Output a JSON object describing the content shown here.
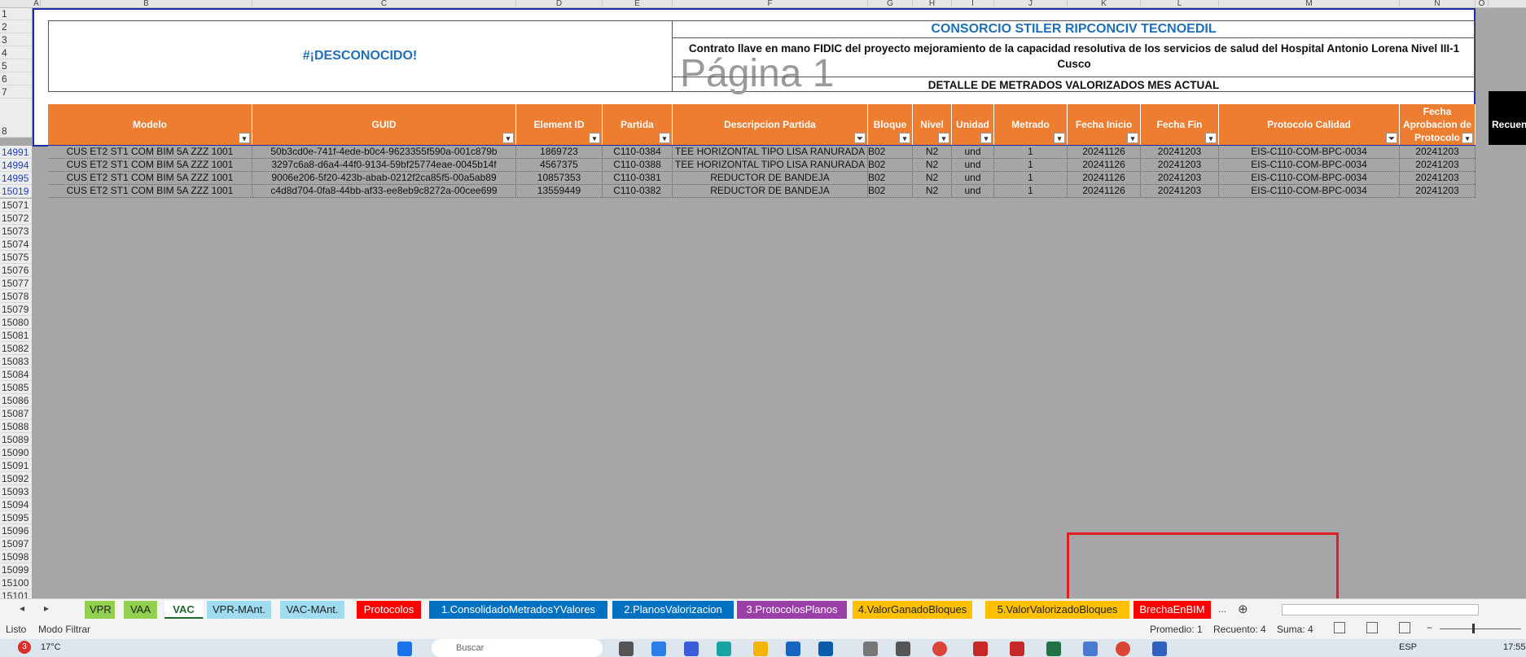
{
  "columns": [
    "A",
    "B",
    "C",
    "D",
    "E",
    "F",
    "G",
    "H",
    "I",
    "J",
    "K",
    "L",
    "M",
    "N",
    "O"
  ],
  "row_numbers_top": [
    "1",
    "2",
    "3",
    "4",
    "5",
    "6",
    "7",
    "8"
  ],
  "row_numbers_data": [
    "14991",
    "14994",
    "14995",
    "15019"
  ],
  "row_numbers_empty": [
    "15071",
    "15072",
    "15073",
    "15074",
    "15075",
    "15076",
    "15077",
    "15078",
    "15079",
    "15080",
    "15081",
    "15082",
    "15083",
    "15084",
    "15085",
    "15086",
    "15087",
    "15088",
    "15089",
    "15090",
    "15091",
    "15092",
    "15093",
    "15094",
    "15095",
    "15096",
    "15097",
    "15098",
    "15099",
    "15100",
    "15101"
  ],
  "header": {
    "desconocido": "#¡DESCONOCIDO!",
    "consorcio": "CONSORCIO STILER RIPCONCIV TECNOEDIL",
    "contrato": "Contrato llave en mano FIDIC del proyecto mejoramiento de la capacidad resolutiva de los servicios de salud del Hospital Antonio Lorena Nivel III-1 Cusco",
    "pagina": "Página 1",
    "detalle": "DETALLE DE METRADOS VALORIZADOS MES ACTUAL"
  },
  "table": {
    "headers": [
      "Modelo",
      "GUID",
      "Element ID",
      "Partida",
      "Descripcion Partida",
      "Bloque",
      "Nivel",
      "Unidad",
      "Metrado",
      "Fecha Inicio",
      "Fecha Fin",
      "Protocolo Calidad",
      "Fecha Aprobacion de Protocolo"
    ],
    "rows": [
      [
        "CUS ET2 ST1 COM BIM 5A ZZZ 1001",
        "50b3cd0e-741f-4ede-b0c4-9623355f590a-001c879b",
        "1869723",
        "C110-0384",
        "TEE HORIZONTAL TIPO LISA RANURADA",
        "B02",
        "N2",
        "und",
        "1",
        "20241126",
        "20241203",
        "EIS-C110-COM-BPC-0034",
        "20241203"
      ],
      [
        "CUS ET2 ST1 COM BIM 5A ZZZ 1001",
        "3297c6a8-d6a4-44f0-9134-59bf25774eae-0045b14f",
        "4567375",
        "C110-0388",
        "TEE HORIZONTAL TIPO LISA RANURADA",
        "B02",
        "N2",
        "und",
        "1",
        "20241126",
        "20241203",
        "EIS-C110-COM-BPC-0034",
        "20241203"
      ],
      [
        "CUS ET2 ST1 COM BIM 5A ZZZ 1001",
        "9006e206-5f20-423b-abab-0212f2ca85f5-00a5ab89",
        "10857353",
        "C110-0381",
        "REDUCTOR DE BANDEJA",
        "B02",
        "N2",
        "und",
        "1",
        "20241126",
        "20241203",
        "EIS-C110-COM-BPC-0034",
        "20241203"
      ],
      [
        "CUS ET2 ST1 COM BIM 5A ZZZ 1001",
        "c4d8d704-0fa8-44bb-af33-ee8eb9c8272a-00cee699",
        "13559449",
        "C110-0382",
        "REDUCTOR DE BANDEJA",
        "B02",
        "N2",
        "und",
        "1",
        "20241126",
        "20241203",
        "EIS-C110-COM-BPC-0034",
        "20241203"
      ]
    ]
  },
  "recuento_label": "Recuento",
  "sheet_tabs": [
    {
      "label": "VPR",
      "bg": "#92d050",
      "color": "#222"
    },
    {
      "label": "VAA",
      "bg": "#92d050",
      "color": "#222"
    },
    {
      "label": "VAC",
      "bg": "#ffffff",
      "color": "#1e6b2e"
    },
    {
      "label": "VPR-MAnt.",
      "bg": "#9fdcf0",
      "color": "#222"
    },
    {
      "label": "VAC-MAnt.",
      "bg": "#9fdcf0",
      "color": "#222"
    },
    {
      "label": "Protocolos",
      "bg": "#ff0000",
      "color": "#fff"
    },
    {
      "label": "1.ConsolidadoMetradosYValores",
      "bg": "#0070c0",
      "color": "#fff"
    },
    {
      "label": "2.PlanosValorizacion",
      "bg": "#0070c0",
      "color": "#fff"
    },
    {
      "label": "3.ProtocolosPlanos",
      "bg": "#9b3fa8",
      "color": "#fff"
    },
    {
      "label": "4.ValorGanadoBloques",
      "bg": "#ffc000",
      "color": "#222"
    },
    {
      "label": "5.ValorValorizadoBloques",
      "bg": "#ffc000",
      "color": "#222"
    },
    {
      "label": "BrechaEnBIM",
      "bg": "#ff0000",
      "color": "#fff"
    }
  ],
  "tabs_more": "...",
  "status": {
    "listo": "Listo",
    "modo": "Modo Filtrar",
    "promedio": "Promedio: 1",
    "recuento": "Recuento: 4",
    "suma": "Suma: 4"
  },
  "taskbar": {
    "badge": "3",
    "weather": "17°C",
    "search": "Buscar",
    "lang": "ESP",
    "time": "17:55"
  }
}
